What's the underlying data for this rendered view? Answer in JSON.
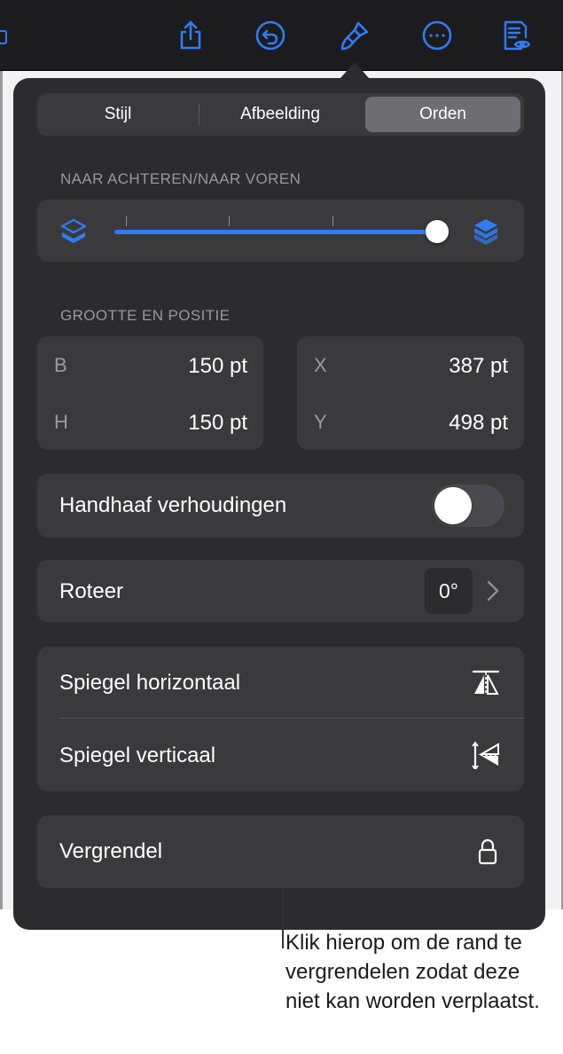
{
  "toolbar": {
    "icons": [
      "share-icon",
      "undo-icon",
      "format-brush-icon",
      "more-icon",
      "reading-view-icon"
    ],
    "accent": "#2f7cf6"
  },
  "tabs": [
    {
      "label": "Stijl",
      "active": false
    },
    {
      "label": "Afbeelding",
      "active": false
    },
    {
      "label": "Orden",
      "active": true
    }
  ],
  "arrange": {
    "title": "NAAR ACHTEREN/NAAR VOREN",
    "slider_value": 1.0
  },
  "size_position": {
    "title": "GROOTTE EN POSITIE",
    "width_label": "B",
    "width_value": "150 pt",
    "height_label": "H",
    "height_value": "150 pt",
    "x_label": "X",
    "x_value": "387 pt",
    "y_label": "Y",
    "y_value": "498 pt"
  },
  "constrain": {
    "label": "Handhaaf verhoudingen",
    "on": false
  },
  "rotate": {
    "label": "Roteer",
    "value": "0°"
  },
  "flip": {
    "horizontal_label": "Spiegel horizontaal",
    "vertical_label": "Spiegel verticaal"
  },
  "lock": {
    "label": "Vergrendel"
  },
  "callout": {
    "text": "Klik hierop om de rand te vergrendelen zodat deze niet kan worden verplaatst."
  }
}
